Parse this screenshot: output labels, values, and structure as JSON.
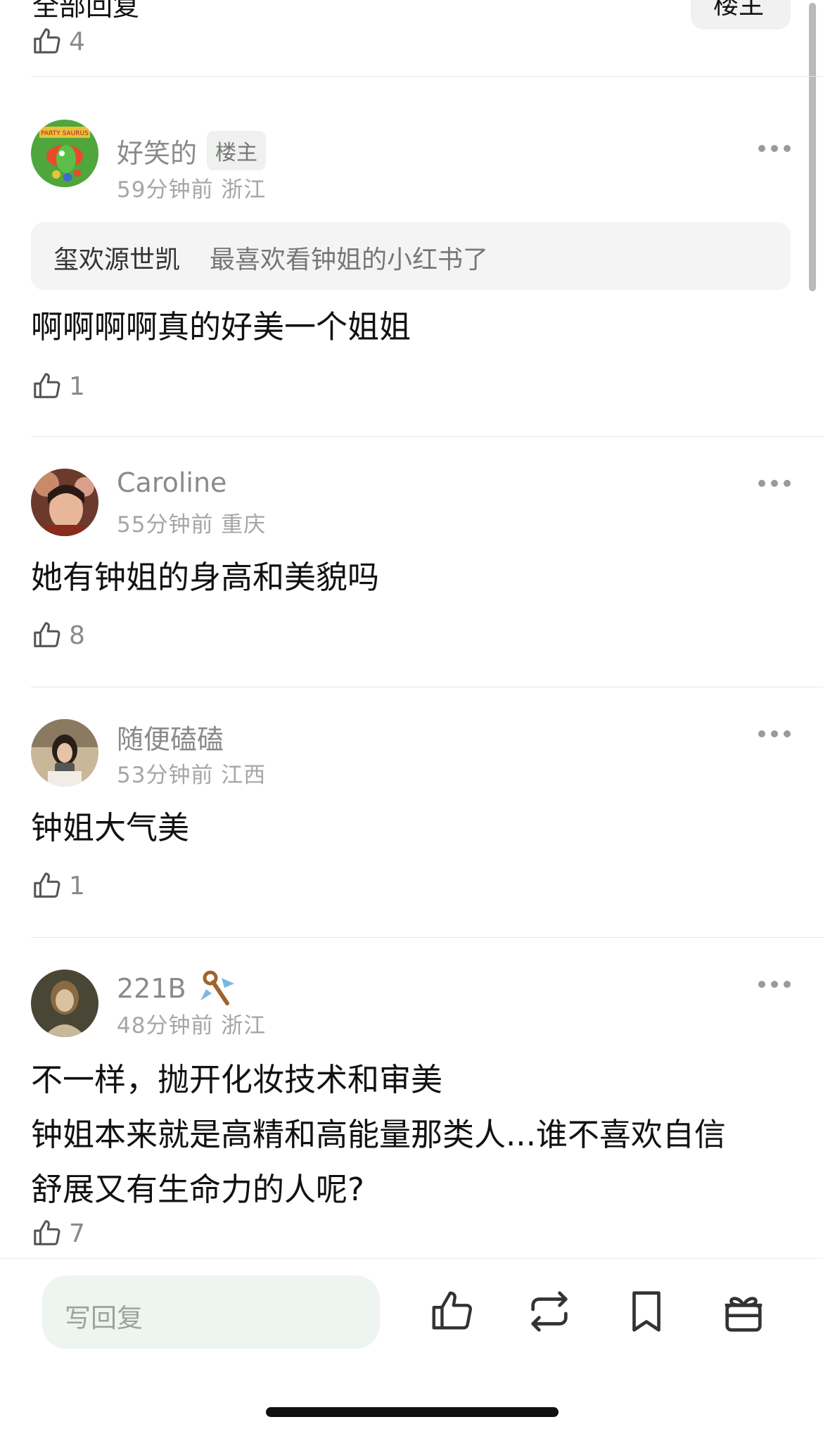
{
  "header": {
    "title": "全部回复",
    "button_label": "楼主"
  },
  "top_like_count": "4",
  "comments": [
    {
      "username": "好笑的",
      "badge": "楼主",
      "meta": "59分钟前 浙江",
      "quote_user": "玺欢源世凯",
      "quote_text": "最喜欢看钟姐的小红书了",
      "text_lines": [
        "啊啊啊啊真的好美一个姐姐"
      ],
      "likes": "1",
      "avatar_text": "PARTY SAURUS"
    },
    {
      "username": "Caroline",
      "meta": "55分钟前 重庆",
      "text_lines": [
        "她有钟姐的身高和美貌吗"
      ],
      "likes": "8"
    },
    {
      "username": "随便磕磕",
      "meta": "53分钟前 江西",
      "text_lines": [
        "钟姐大气美"
      ],
      "likes": "1"
    },
    {
      "username": "221B",
      "meta": "48分钟前 浙江",
      "text_lines": [
        "不一样，抛开化妆技术和审美",
        "钟姐本来就是高精和高能量那类人...谁不喜欢自信",
        "舒展又有生命力的人呢?"
      ],
      "likes": "7"
    }
  ],
  "bottom_bar": {
    "reply_placeholder": "写回复"
  },
  "icons": [
    "thumbs-up-icon",
    "more-dots-icon",
    "repost-icon",
    "bookmark-icon",
    "gift-icon",
    "badge-key-icon"
  ],
  "colors": {
    "accent_input": "#eef4ef",
    "meta_gray": "#a6a6a6",
    "name_gray": "#8a8a8a"
  }
}
